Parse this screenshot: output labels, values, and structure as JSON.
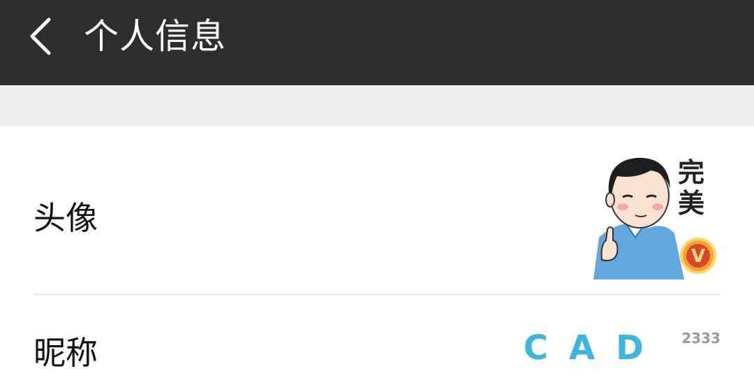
{
  "header": {
    "title": "个人信息",
    "back_icon": "chevron-left-icon"
  },
  "rows": [
    {
      "label": "头像",
      "avatar": {
        "caption": "完美",
        "badge": "V"
      }
    },
    {
      "label": "昵称",
      "value": "CAD",
      "value_suffix": "2333"
    }
  ],
  "colors": {
    "header_bg": "#2f2d2f",
    "spacer_bg": "#ededee",
    "nickname_accent": "#3cb5e3",
    "badge_gold": "#f3a62b"
  }
}
